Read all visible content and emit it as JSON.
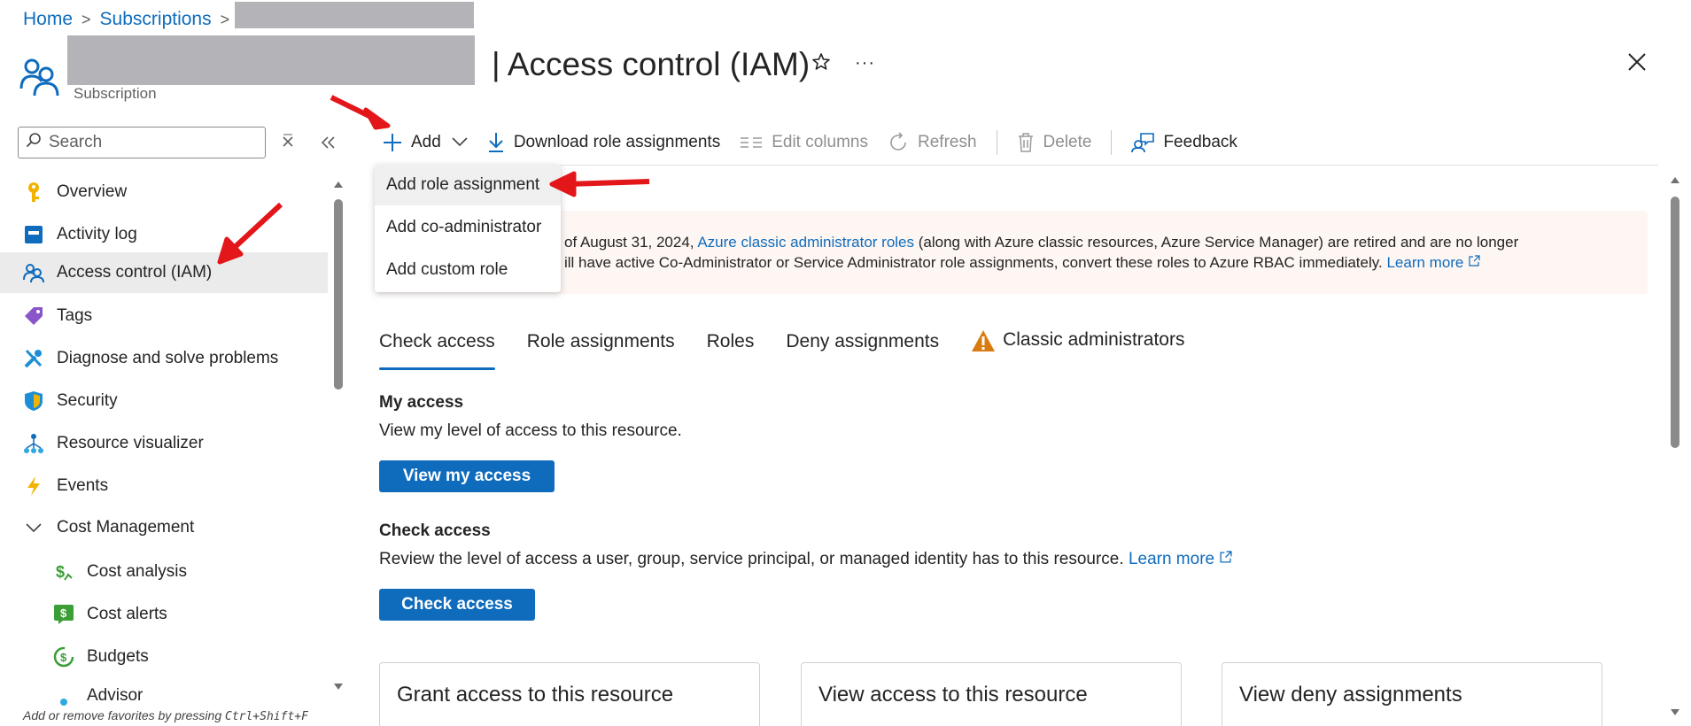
{
  "breadcrumb": {
    "home": "Home",
    "subscriptions": "Subscriptions",
    "sep": ">"
  },
  "header": {
    "title": "| Access control (IAM)",
    "type_label": "Subscription",
    "star_icon": "star-icon",
    "more": "···"
  },
  "search": {
    "placeholder": "Search"
  },
  "sidebar": {
    "items": [
      {
        "label": "Overview",
        "icon": "key-icon"
      },
      {
        "label": "Activity log",
        "icon": "activity-log-icon"
      },
      {
        "label": "Access control (IAM)",
        "icon": "people-icon"
      },
      {
        "label": "Tags",
        "icon": "tag-icon"
      },
      {
        "label": "Diagnose and solve problems",
        "icon": "wrench-icon"
      },
      {
        "label": "Security",
        "icon": "shield-icon"
      },
      {
        "label": "Resource visualizer",
        "icon": "visualizer-icon"
      },
      {
        "label": "Events",
        "icon": "lightning-icon"
      },
      {
        "label": "Cost Management",
        "icon": "chevron-down-icon"
      },
      {
        "label": "Cost analysis",
        "icon": "cost-analysis-icon"
      },
      {
        "label": "Cost alerts",
        "icon": "cost-alerts-icon"
      },
      {
        "label": "Budgets",
        "icon": "budgets-icon"
      },
      {
        "label": "Advisor",
        "icon": "advisor-icon"
      }
    ],
    "footer": "Add or remove favorites by pressing",
    "shortcut": "Ctrl+Shift+F"
  },
  "toolbar": {
    "add": "Add",
    "download": "Download role assignments",
    "edit_columns": "Edit columns",
    "refresh": "Refresh",
    "delete": "Delete",
    "feedback": "Feedback"
  },
  "add_menu": {
    "items": [
      "Add role assignment",
      "Add co-administrator",
      "Add custom role"
    ]
  },
  "banner": {
    "line1_pre": "of August 31, 2024,",
    "line1_link": "Azure classic administrator roles",
    "line1_post": "(along with Azure classic resources, Azure Service Manager) are retired and are no longer",
    "line2_pre": "ill have active Co-Administrator or Service Administrator role assignments, convert these roles to Azure RBAC immediately.",
    "line2_link": "Learn more"
  },
  "tabs": [
    "Check access",
    "Role assignments",
    "Roles",
    "Deny assignments",
    "Classic administrators"
  ],
  "my_access": {
    "heading": "My access",
    "description": "View my level of access to this resource.",
    "button": "View my access"
  },
  "check_access": {
    "heading": "Check access",
    "description": "Review the level of access a user, group, service principal, or managed identity has to this resource.",
    "link": "Learn more",
    "button": "Check access"
  },
  "cards": [
    "Grant access to this resource",
    "View access to this resource",
    "View deny assignments"
  ],
  "colors": {
    "accent": "#0f6cbd",
    "annotation_arrow": "#e3161a",
    "warning": "#da7b11"
  }
}
